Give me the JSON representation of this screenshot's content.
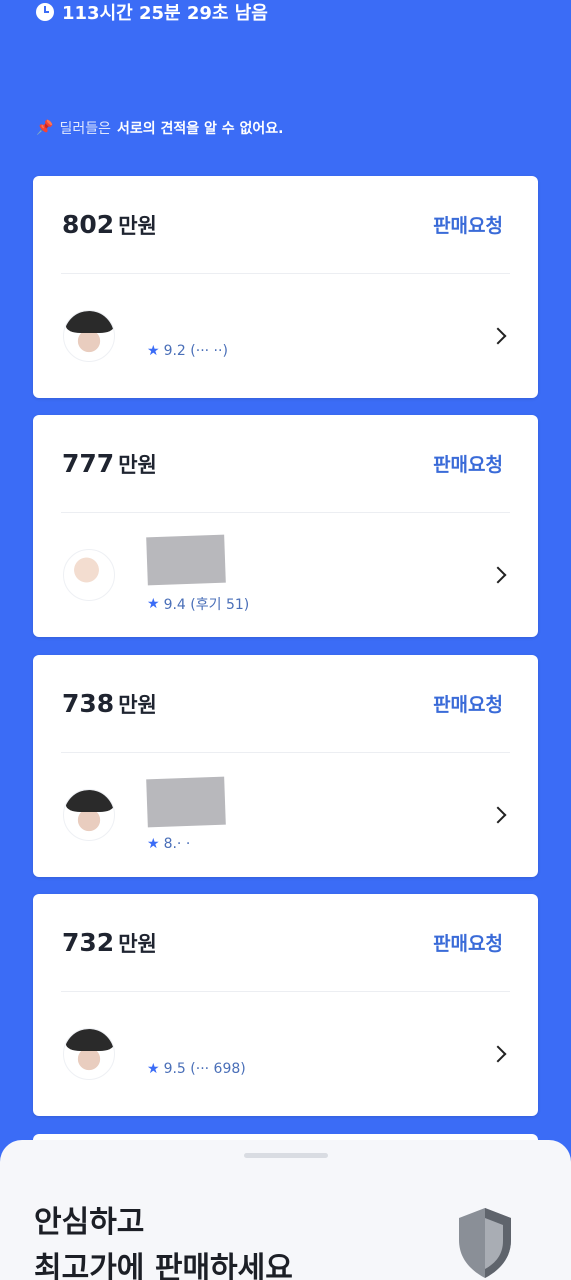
{
  "timer": {
    "text": "113시간 25분 29초 남음"
  },
  "notice": {
    "pin": "📌",
    "prefix": "딜러들은",
    "emphasis": "서로의 견적을 알 수 없어요."
  },
  "offers": [
    {
      "price": "802",
      "unit": "만원",
      "action": "판매요청",
      "rating": "9.2 (··· ··)"
    },
    {
      "price": "777",
      "unit": "만원",
      "action": "판매요청",
      "rating": "9.4 (후기 51)"
    },
    {
      "price": "738",
      "unit": "만원",
      "action": "판매요청",
      "rating": "8.· ·"
    },
    {
      "price": "732",
      "unit": "만원",
      "action": "판매요청",
      "rating": "9.5 (··· 698)"
    }
  ],
  "sheet": {
    "line1": "안심하고",
    "line2": "최고가에 판매하세요"
  },
  "colors": {
    "background": "#3b6cf6",
    "action": "#3a6bd8",
    "text": "#1f2430"
  }
}
